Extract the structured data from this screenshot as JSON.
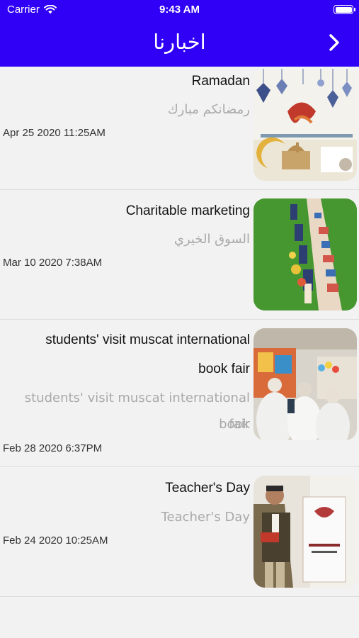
{
  "status_bar": {
    "carrier": "Carrier",
    "time": "9:43 AM"
  },
  "header": {
    "title": "اخبارنا"
  },
  "news": [
    {
      "title": "Ramadan",
      "subtitle": "رمضانكم مبارك",
      "date": "Apr 25 2020 11:25AM"
    },
    {
      "title": "Charitable marketing",
      "subtitle": "السوق الخيري",
      "date": "Mar 10 2020  7:38AM"
    },
    {
      "title_line1": "students' visit muscat international",
      "title_line2": "book fair",
      "subtitle_line1": "students' visit muscat international book",
      "subtitle_line2": "fair",
      "date": "Feb 28 2020  6:37PM"
    },
    {
      "title": "Teacher's Day",
      "subtitle": "Teacher's Day",
      "date": "Feb 24 2020 10:25AM"
    }
  ]
}
